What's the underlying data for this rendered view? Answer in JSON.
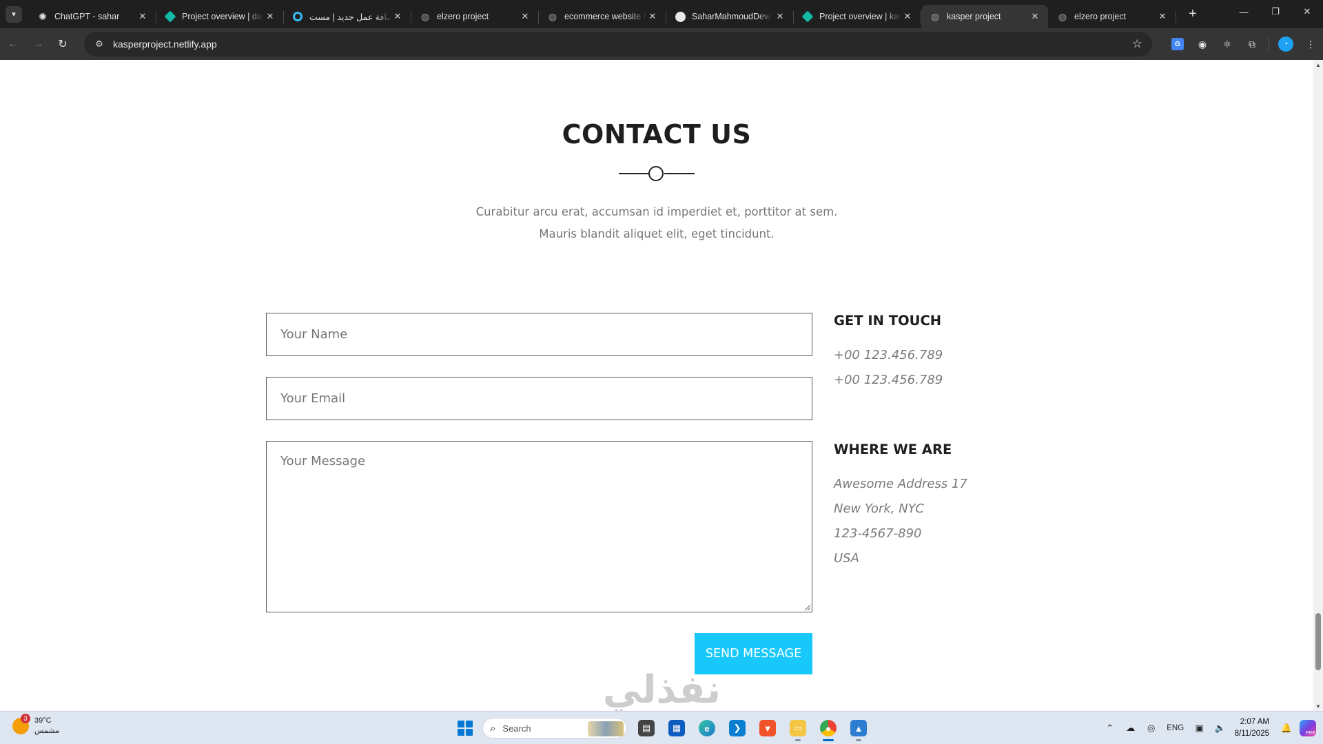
{
  "browser": {
    "tabs": [
      {
        "title": "ChatGPT - sahar",
        "favicon": "chatgpt-icon",
        "active": false
      },
      {
        "title": "Project overview | das",
        "favicon": "netlify-icon",
        "active": false
      },
      {
        "title": "إضافة عمل جديد | مست",
        "favicon": "mostaql-icon",
        "active": false
      },
      {
        "title": "elzero project",
        "favicon": "globe-icon",
        "active": false
      },
      {
        "title": "ecommerce website f",
        "favicon": "globe-icon",
        "active": false
      },
      {
        "title": "SaharMahmoudDev/",
        "favicon": "github-icon",
        "active": false
      },
      {
        "title": "Project overview | kas",
        "favicon": "netlify-icon",
        "active": false
      },
      {
        "title": "kasper project",
        "favicon": "globe-icon",
        "active": true
      },
      {
        "title": "elzero project",
        "favicon": "globe-icon",
        "active": false
      }
    ],
    "url": "kasperproject.netlify.app"
  },
  "page": {
    "title": "CONTACT US",
    "description": "Curabitur arcu erat, accumsan id imperdiet et, porttitor at sem. Mauris blandit aliquet elit, eget tincidunt.",
    "form": {
      "name_placeholder": "Your Name",
      "email_placeholder": "Your Email",
      "message_placeholder": "Your Message",
      "submit_label": "SEND MESSAGE"
    },
    "get_in_touch": {
      "heading": "GET IN TOUCH",
      "phones": [
        "+00 123.456.789",
        "+00 123.456.789"
      ]
    },
    "where_we_are": {
      "heading": "WHERE WE ARE",
      "lines": [
        "Awesome Address 17",
        "New York, NYC",
        "123-4567-890",
        "USA"
      ]
    },
    "watermark": "نفذلي"
  },
  "taskbar": {
    "weather": {
      "temp": "39°C",
      "condition": "مشمس",
      "badge": "3"
    },
    "search_placeholder": "Search",
    "language": "ENG",
    "time": "2:07 AM",
    "date": "8/11/2025",
    "copilot_badge": "PRE"
  },
  "colors": {
    "accent": "#19c8fa",
    "tabstrip": "#1f1f1f",
    "toolbar": "#353535",
    "taskbar": "#dde6f1"
  }
}
